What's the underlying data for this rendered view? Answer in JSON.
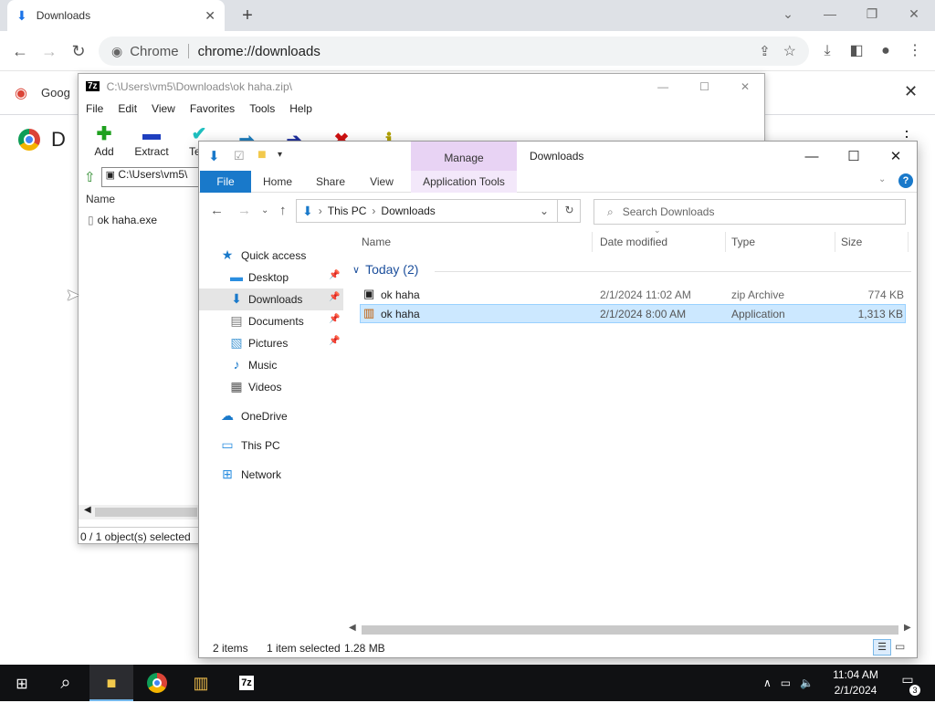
{
  "chrome": {
    "tab_title": "Downloads",
    "omnibox_site": "Chrome",
    "omnibox_url": "chrome://downloads",
    "bookmark_label": "Goog",
    "page_title_fragment": "D"
  },
  "sevenzip": {
    "title_path": "C:\\Users\\vm5\\Downloads\\ok haha.zip\\",
    "menu": [
      "File",
      "Edit",
      "View",
      "Favorites",
      "Tools",
      "Help"
    ],
    "tools": [
      {
        "label": "Add",
        "icon": "add-icon",
        "color": "#1fa01f"
      },
      {
        "label": "Extract",
        "icon": "extract-icon",
        "color": "#1f3fbf"
      },
      {
        "label": "Test",
        "icon": "test-icon",
        "color": "#1fbfbf"
      },
      {
        "label": "",
        "icon": "copy-icon",
        "color": "#1f7fbf"
      },
      {
        "label": "",
        "icon": "move-icon",
        "color": "#1f2f9f"
      },
      {
        "label": "",
        "icon": "delete-icon",
        "color": "#d01010"
      },
      {
        "label": "",
        "icon": "info-icon",
        "color": "#b0a000"
      }
    ],
    "path_box": "C:\\Users\\vm5\\",
    "column_name": "Name",
    "file": "ok haha.exe",
    "status": "0 / 1 object(s) selected"
  },
  "explorer": {
    "title": "Downloads",
    "manage_label": "Manage",
    "ribbon_tabs": [
      "File",
      "Home",
      "Share",
      "View",
      "Application Tools"
    ],
    "breadcrumb": [
      "This PC",
      "Downloads"
    ],
    "search_placeholder": "Search Downloads",
    "nav": {
      "quick_access": "Quick access",
      "desktop": "Desktop",
      "downloads": "Downloads",
      "documents": "Documents",
      "pictures": "Pictures",
      "music": "Music",
      "videos": "Videos",
      "onedrive": "OneDrive",
      "thispc": "This PC",
      "network": "Network"
    },
    "columns": [
      "Name",
      "Date modified",
      "Type",
      "Size"
    ],
    "group": "Today (2)",
    "files": [
      {
        "name": "ok haha",
        "date": "2/1/2024 11:02 AM",
        "type": "zip Archive",
        "size": "774 KB"
      },
      {
        "name": "ok haha",
        "date": "2/1/2024 8:00 AM",
        "type": "Application",
        "size": "1,313 KB"
      }
    ],
    "status_items": "2 items",
    "status_selected": "1 item selected",
    "status_size": "1.28 MB"
  },
  "taskbar": {
    "time": "11:04 AM",
    "date": "2/1/2024",
    "notifications": "3"
  }
}
